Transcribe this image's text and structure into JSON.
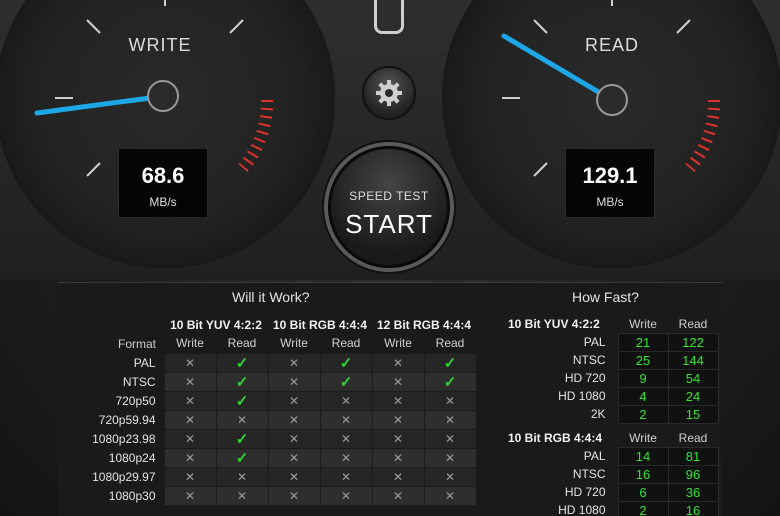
{
  "write_gauge": {
    "label": "WRITE",
    "value": "68.6",
    "unit": "MB/s"
  },
  "read_gauge": {
    "label": "READ",
    "value": "129.1",
    "unit": "MB/s"
  },
  "start_button": {
    "sub_label": "SPEED TEST",
    "label": "START"
  },
  "settings_icon": "gear-icon",
  "will_it_work": {
    "title": "Will it Work?",
    "format_header": "Format",
    "groups": [
      "10 Bit YUV 4:2:2",
      "10 Bit RGB 4:4:4",
      "12 Bit RGB 4:4:4"
    ],
    "subheaders": [
      "Write",
      "Read",
      "Write",
      "Read",
      "Write",
      "Read"
    ],
    "rows": [
      {
        "format": "PAL",
        "cells": [
          "x",
          "ok",
          "x",
          "ok",
          "x",
          "ok"
        ]
      },
      {
        "format": "NTSC",
        "cells": [
          "x",
          "ok",
          "x",
          "ok",
          "x",
          "ok"
        ]
      },
      {
        "format": "720p50",
        "cells": [
          "x",
          "ok",
          "x",
          "x",
          "x",
          "x"
        ]
      },
      {
        "format": "720p59.94",
        "cells": [
          "x",
          "x",
          "x",
          "x",
          "x",
          "x"
        ]
      },
      {
        "format": "1080p23.98",
        "cells": [
          "x",
          "ok",
          "x",
          "x",
          "x",
          "x"
        ]
      },
      {
        "format": "1080p24",
        "cells": [
          "x",
          "ok",
          "x",
          "x",
          "x",
          "x"
        ]
      },
      {
        "format": "1080p29.97",
        "cells": [
          "x",
          "x",
          "x",
          "x",
          "x",
          "x"
        ]
      },
      {
        "format": "1080p30",
        "cells": [
          "x",
          "x",
          "x",
          "x",
          "x",
          "x"
        ]
      }
    ]
  },
  "how_fast": {
    "title": "How Fast?",
    "blocks": [
      {
        "group": "10 Bit YUV 4:2:2",
        "subheaders": [
          "Write",
          "Read"
        ],
        "rows": [
          {
            "format": "PAL",
            "write": "21",
            "read": "122"
          },
          {
            "format": "NTSC",
            "write": "25",
            "read": "144"
          },
          {
            "format": "HD 720",
            "write": "9",
            "read": "54"
          },
          {
            "format": "HD 1080",
            "write": "4",
            "read": "24"
          },
          {
            "format": "2K",
            "write": "2",
            "read": "15"
          }
        ]
      },
      {
        "group": "10 Bit RGB 4:4:4",
        "subheaders": [
          "Write",
          "Read"
        ],
        "rows": [
          {
            "format": "PAL",
            "write": "14",
            "read": "81"
          },
          {
            "format": "NTSC",
            "write": "16",
            "read": "96"
          },
          {
            "format": "HD 720",
            "write": "6",
            "read": "36"
          },
          {
            "format": "HD 1080",
            "write": "2",
            "read": "16"
          }
        ]
      }
    ]
  },
  "colors": {
    "needle": "#1ea7e6",
    "pass": "#33d633",
    "redline": "#e0342a"
  }
}
